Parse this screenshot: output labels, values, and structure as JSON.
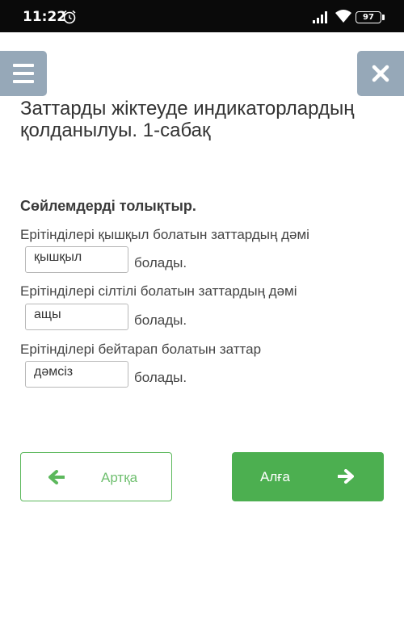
{
  "status_bar": {
    "time": "11:22",
    "battery": "97"
  },
  "header": {
    "title": "Заттарды жіктеуде индикаторлардың қолданылуы. 1-сабақ"
  },
  "exercise": {
    "instruction": "Сөйлемдерді толықтыр.",
    "items": [
      {
        "sentence": "Ерітінділері қышқыл болатын заттардың дәмі",
        "answer": "қышқыл",
        "suffix": "болады."
      },
      {
        "sentence": "Ерітінділері сілтілі болатын заттардың дәмі",
        "answer": "ащы",
        "suffix": "болады."
      },
      {
        "sentence": "Ерітінділері бейтарап болатын заттар",
        "answer": "дәмсіз",
        "suffix": "болады."
      }
    ]
  },
  "navigation": {
    "back_label": "Артқа",
    "next_label": "Алға"
  },
  "colors": {
    "accent_green": "#4caf50",
    "header_button": "#96a8b8"
  },
  "icons": [
    "alarm-icon",
    "signal-icon",
    "wifi-icon",
    "battery-icon",
    "menu-icon",
    "close-icon",
    "arrow-left-icon",
    "arrow-right-icon"
  ]
}
